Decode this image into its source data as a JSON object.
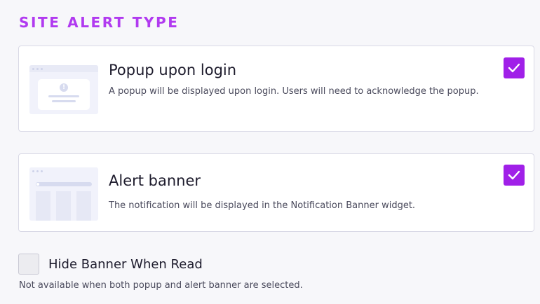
{
  "section_title": "SITE ALERT TYPE",
  "options": [
    {
      "title": "Popup upon login",
      "description": "A popup will be displayed upon login. Users will need to acknowledge the popup.",
      "checked": true,
      "icon": "popup-preview-icon"
    },
    {
      "title": "Alert banner",
      "description": "The notification will be displayed in the Notification Banner widget.",
      "checked": true,
      "icon": "banner-preview-icon"
    }
  ],
  "hide_banner": {
    "label": "Hide Banner When Read",
    "checked": false,
    "hint": "Not available when both popup and alert banner are selected."
  },
  "colors": {
    "accent": "#a020e8",
    "title": "#b13af0"
  }
}
